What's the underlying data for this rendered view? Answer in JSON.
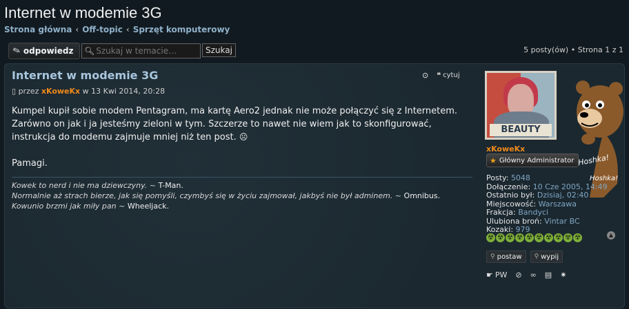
{
  "topic": {
    "title": "Internet w modemie 3G"
  },
  "breadcrumb": {
    "items": [
      "Strona główna",
      "Off-topic",
      "Sprzęt komputerowy"
    ],
    "separator": "‹"
  },
  "toolbar": {
    "reply_label": "odpowiedz",
    "search_placeholder": "Szukaj w temacie…",
    "search_button": "Szukaj",
    "pagination": "5 posty(ów) • Strona 1 z 1"
  },
  "post": {
    "title": "Internet w modemie 3G",
    "cite_label": "cytuj",
    "meta_prefix": "przez",
    "author": "xKoweKx",
    "meta_suffix": "w 13 Kwi 2014, 20:28",
    "paragraph1": "Kumpel kupił sobie modem Pentagram, ma kartę Aero2 jednak nie może połączyć się z Internetem. Zarówno on jak i ja jesteśmy zieloni w tym. Szczerze to nawet nie wiem jak to skonfigurować, instrukcja do modemu zajmuje mniej niż ten post.",
    "paragraph2": "Pamagi.",
    "signature": [
      {
        "quote": "Kowek to nerd i nie ma dziewczyny. ~",
        "who": "T-Man."
      },
      {
        "quote": "Normalnie aż strach bierze, jak się pomyśli, czymbyś się w życiu zajmował, jakbyś nie był adminem. ~",
        "who": "Omnibus."
      },
      {
        "quote": "Kowunio brzmi jak miły pan ~",
        "who": "Wheeljack."
      }
    ]
  },
  "profile": {
    "avatar_label": "BEAUTY",
    "name": "xKoweKx",
    "rank": "Główny Administrator",
    "stats": [
      {
        "label": "Posty:",
        "value": "5048"
      },
      {
        "label": "Dołączenie:",
        "value": "10 Cze 2005, 14:49"
      },
      {
        "label": "Ostatnio był:",
        "value": "Dzisiaj, 02:40"
      },
      {
        "label": "Miejscowość:",
        "value": "Warszawa"
      },
      {
        "label": "Frakcja:",
        "value": "Bandyci"
      },
      {
        "label": "Ulubiona broń:",
        "value": "Vintar BC"
      },
      {
        "label": "Kozaki:",
        "value": "979"
      }
    ],
    "badge_count": 10,
    "buttons": [
      "postaw",
      "wypij"
    ],
    "pw_label": "PW",
    "hoshka": [
      "Hoshka!",
      "Hoshka!"
    ]
  },
  "colors": {
    "accent": "#a8c6de",
    "author": "#f08a1a",
    "link": "#8fb0c8",
    "background": "#111a20"
  }
}
